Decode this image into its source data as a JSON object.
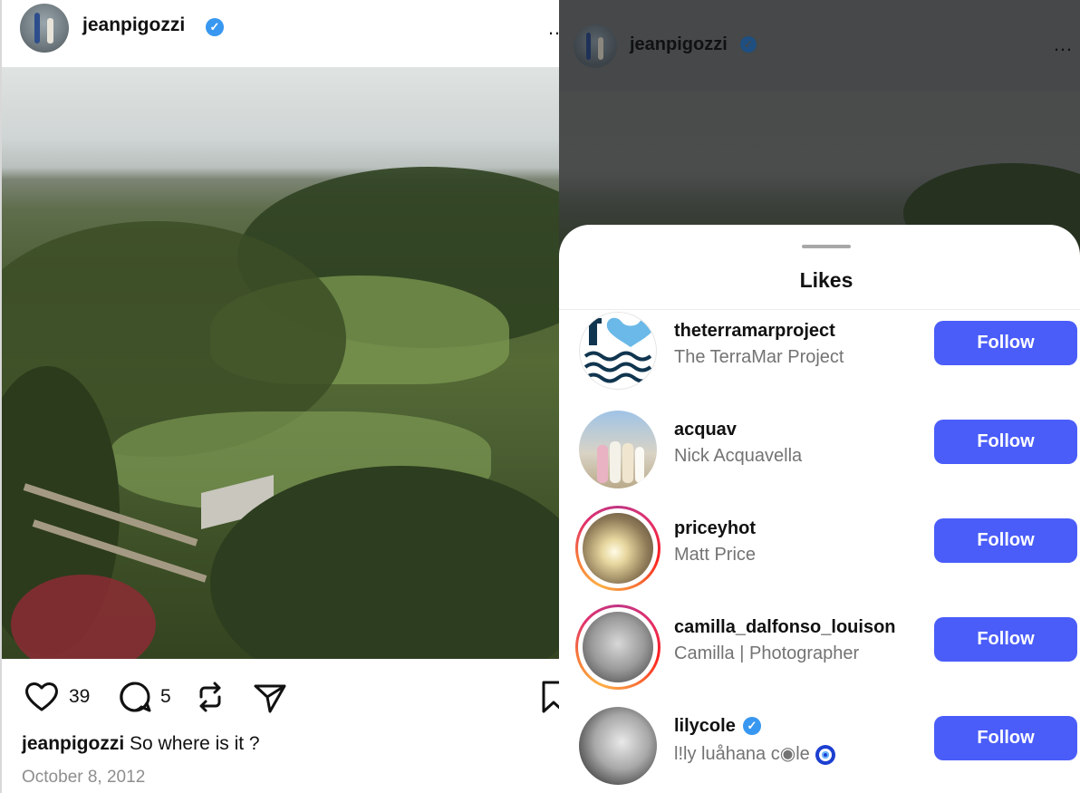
{
  "post": {
    "username": "jeanpigozzi",
    "verified_mark": "✓",
    "more_icon": "…",
    "likes_count": "39",
    "comments_count": "5",
    "caption_user": "jeanpigozzi",
    "caption_text": "So where is it ?",
    "date": "October 8, 2012",
    "photo_description_icon": "landscape-photo"
  },
  "overlay": {
    "header_username": "jeanpigozzi",
    "more_icon": "…"
  },
  "likes_sheet": {
    "title": "Likes",
    "follow_color": "#4a5df9",
    "users": [
      {
        "username": "theterramarproject",
        "full_name": "The TerraMar Project",
        "button": "Follow",
        "verified": false,
        "story_ring": false
      },
      {
        "username": "acquav",
        "full_name": "Nick Acquavella",
        "button": "Follow",
        "verified": false,
        "story_ring": false
      },
      {
        "username": "priceyhot",
        "full_name": "Matt Price",
        "button": "Follow",
        "verified": false,
        "story_ring": true
      },
      {
        "username": "camilla_dalfonso_louison",
        "full_name": "Camilla | Photographer",
        "button": "Follow",
        "verified": false,
        "story_ring": true
      },
      {
        "username": "lilycole",
        "full_name": "l!ly luåhana c◉le",
        "button": "Follow",
        "verified": true,
        "story_ring": false
      }
    ]
  }
}
